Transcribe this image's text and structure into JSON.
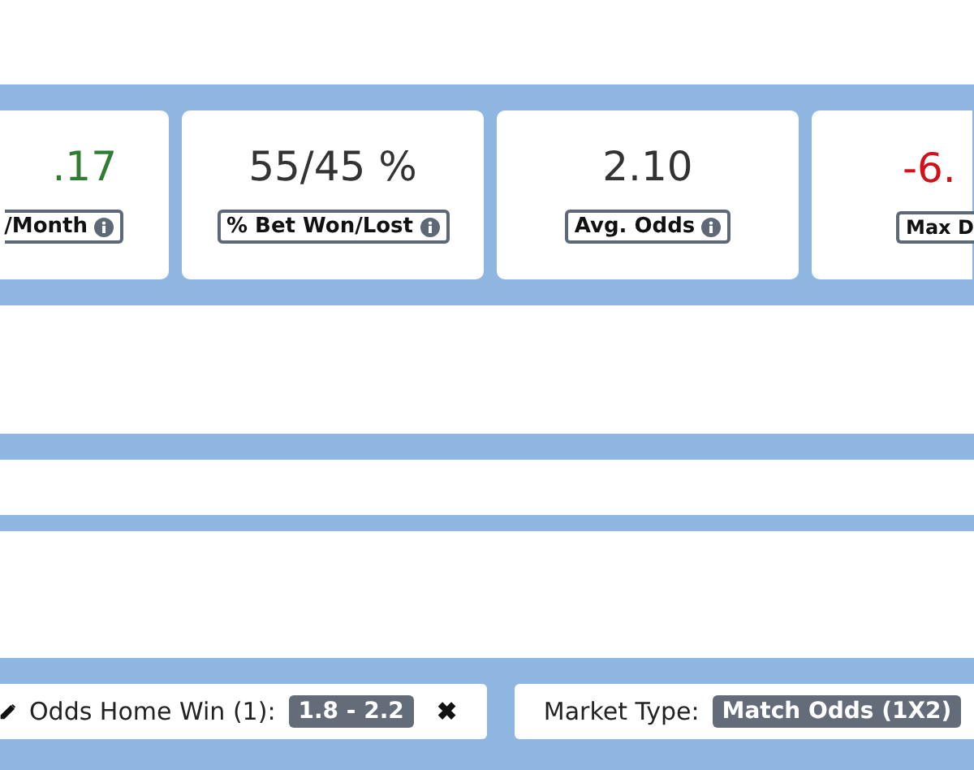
{
  "stats": [
    {
      "value": ".17",
      "label": "/Month",
      "color": "#2e7d32"
    },
    {
      "value": "55/45 %",
      "label": "% Bet Won/Lost",
      "color": "#333333"
    },
    {
      "value": "2.10",
      "label": "Avg. Odds",
      "color": "#333333"
    },
    {
      "value": "-6.",
      "label": "Max D",
      "color": "#d0121b"
    }
  ],
  "filters": [
    {
      "label": "Odds Home Win (1):",
      "value": "1.8 - 2.2",
      "editable": true,
      "remove": "✖"
    },
    {
      "label": "Market Type:",
      "value": "Match Odds (1X2)",
      "editable": false
    }
  ]
}
